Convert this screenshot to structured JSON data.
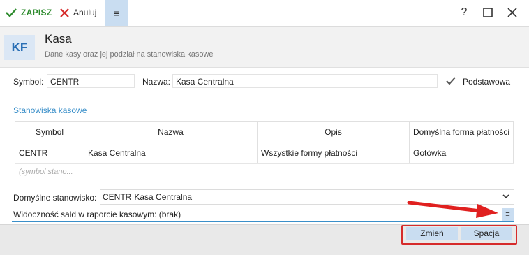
{
  "toolbar": {
    "save_label": "ZAPISZ",
    "cancel_label": "Anuluj",
    "menu_glyph": "≡"
  },
  "window_controls": {
    "help": "?",
    "maximize": "☐",
    "close": "✕"
  },
  "header": {
    "badge": "KF",
    "title": "Kasa",
    "subtitle": "Dane kasy oraz jej podział na stanowiska kasowe"
  },
  "form": {
    "symbol_label": "Symbol:",
    "symbol_value": "CENTR",
    "name_label": "Nazwa:",
    "name_value": "Kasa Centralna",
    "default_label": "Podstawowa",
    "default_checked": true
  },
  "stations": {
    "title": "Stanowiska kasowe",
    "columns": [
      "Symbol",
      "Nazwa",
      "Opis",
      "Domyślna forma płatności"
    ],
    "rows": [
      {
        "symbol": "CENTR",
        "name": "Kasa Centralna",
        "description": "Wszystkie formy płatności",
        "payment": "Gotówka"
      }
    ],
    "new_row_placeholder": "(symbol stano..."
  },
  "default_station": {
    "label": "Domyślne stanowisko:",
    "code": "CENTR",
    "name": "Kasa Centralna"
  },
  "visibility": {
    "text": "Widoczność sald w raporcie kasowym: (brak)",
    "menu_glyph": "≡"
  },
  "actions": {
    "change_label": "Zmień",
    "key_label": "Spacja"
  },
  "colors": {
    "accent": "#3a8fc9",
    "save_green": "#2e8b2e",
    "cancel_red": "#d62b2b",
    "highlight": "#c9ddf1",
    "annotation_red": "#e0201f"
  }
}
